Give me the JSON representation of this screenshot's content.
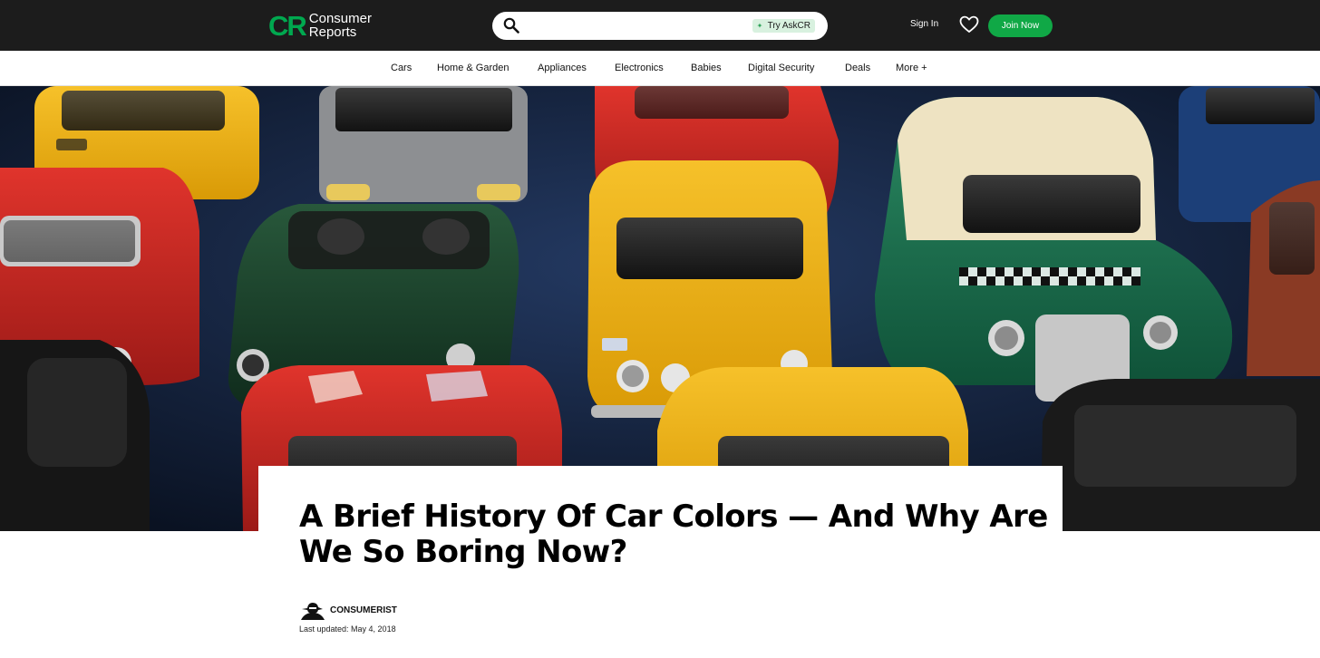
{
  "header": {
    "logo_mark": "CR",
    "logo_line1": "Consumer",
    "logo_line2": "Reports",
    "search_placeholder": "",
    "askcr_label": "Try AskCR",
    "signin_label": "Sign In",
    "join_label": "Join Now",
    "icons": [
      "search-icon",
      "heart-icon",
      "sparkle-icon"
    ]
  },
  "nav": {
    "items": [
      "Cars",
      "Home & Garden",
      "Appliances",
      "Electronics",
      "Babies",
      "Digital Security",
      "Deals",
      "More +"
    ]
  },
  "article": {
    "title": "A Brief History Of Car Colors — And Why Are We So Boring Now?",
    "author": "CONSUMERIST",
    "updated": "Last updated: May 4, 2018"
  },
  "colors": {
    "brand_green": "#00a84f",
    "join_green": "#10a846",
    "header_bg": "#1c1c1c"
  }
}
